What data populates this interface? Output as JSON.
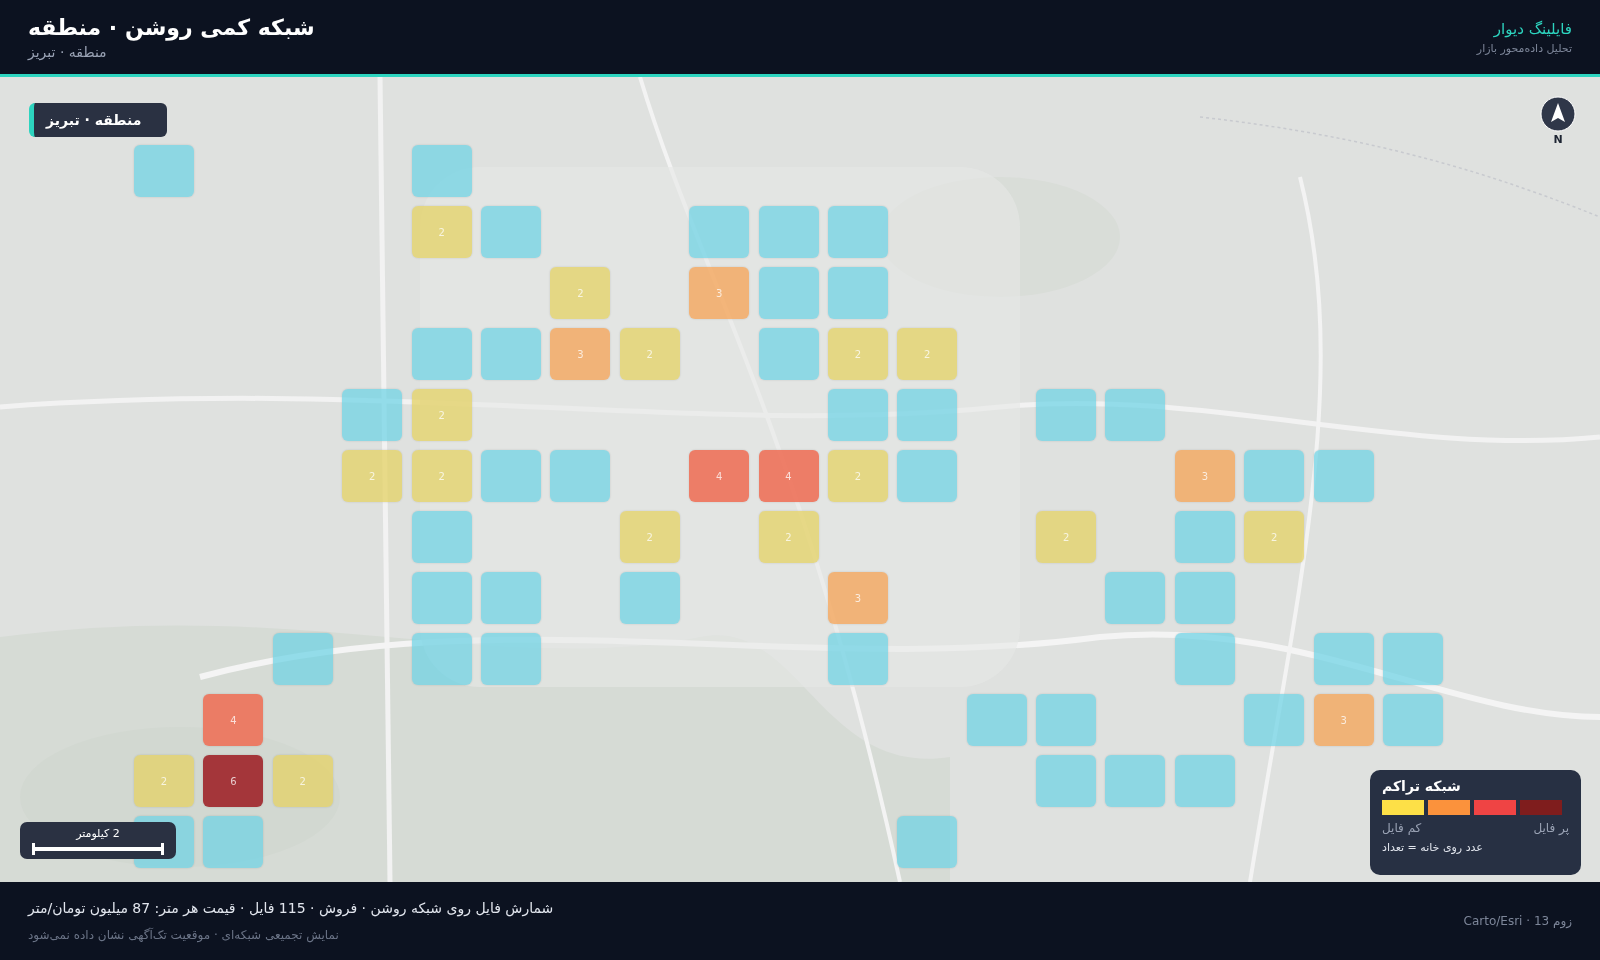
{
  "header": {
    "title": "شبکه کمی روشن · منطقه",
    "subtitle": "منطقه · تبریز",
    "brand": "فایلینگ دیوار",
    "tagline": "تحلیل داده‌محور بازار"
  },
  "map": {
    "badge": "منطقه · تبریز",
    "north": "N",
    "scale": "2 کیلومتر",
    "grid": {
      "rows": [
        [
          {
            "kind": "none"
          },
          {
            "kind": "none"
          },
          {
            "kind": "none"
          },
          {
            "kind": "none"
          },
          {
            "kind": "none"
          },
          {
            "kind": "none"
          },
          {
            "kind": "none"
          },
          {
            "kind": "none"
          },
          {
            "kind": "none"
          },
          {
            "kind": "none"
          },
          {
            "kind": "none"
          },
          {
            "kind": "none"
          },
          {
            "kind": "none"
          },
          {
            "kind": "none"
          },
          {
            "kind": "one"
          },
          {
            "kind": "none"
          },
          {
            "kind": "none"
          },
          {
            "kind": "none"
          },
          {
            "kind": "one"
          }
        ],
        [
          {
            "kind": "none"
          },
          {
            "kind": "none"
          },
          {
            "kind": "none"
          },
          {
            "kind": "none"
          },
          {
            "kind": "none"
          },
          {
            "kind": "none"
          },
          {
            "kind": "none"
          },
          {
            "kind": "none"
          },
          {
            "kind": "one"
          },
          {
            "kind": "one"
          },
          {
            "kind": "one"
          },
          {
            "kind": "none"
          },
          {
            "kind": "none"
          },
          {
            "kind": "one"
          },
          {
            "kind": "low",
            "count": "2"
          },
          {
            "kind": "none"
          },
          {
            "kind": "none"
          },
          {
            "kind": "none"
          },
          {
            "kind": "none"
          }
        ],
        [
          {
            "kind": "none"
          },
          {
            "kind": "none"
          },
          {
            "kind": "none"
          },
          {
            "kind": "none"
          },
          {
            "kind": "none"
          },
          {
            "kind": "none"
          },
          {
            "kind": "none"
          },
          {
            "kind": "none"
          },
          {
            "kind": "one"
          },
          {
            "kind": "one"
          },
          {
            "kind": "mid",
            "count": "3"
          },
          {
            "kind": "none"
          },
          {
            "kind": "low",
            "count": "2"
          },
          {
            "kind": "none"
          },
          {
            "kind": "none"
          },
          {
            "kind": "none"
          },
          {
            "kind": "none"
          },
          {
            "kind": "none"
          },
          {
            "kind": "none"
          }
        ],
        [
          {
            "kind": "none"
          },
          {
            "kind": "none"
          },
          {
            "kind": "none"
          },
          {
            "kind": "none"
          },
          {
            "kind": "none"
          },
          {
            "kind": "none"
          },
          {
            "kind": "none"
          },
          {
            "kind": "low",
            "count": "2"
          },
          {
            "kind": "low",
            "count": "2"
          },
          {
            "kind": "one"
          },
          {
            "kind": "none"
          },
          {
            "kind": "low",
            "count": "2"
          },
          {
            "kind": "mid",
            "count": "3"
          },
          {
            "kind": "one"
          },
          {
            "kind": "one"
          },
          {
            "kind": "none"
          },
          {
            "kind": "none"
          },
          {
            "kind": "none"
          },
          {
            "kind": "none"
          }
        ],
        [
          {
            "kind": "none"
          },
          {
            "kind": "none"
          },
          {
            "kind": "none"
          },
          {
            "kind": "none"
          },
          {
            "kind": "one"
          },
          {
            "kind": "one"
          },
          {
            "kind": "none"
          },
          {
            "kind": "one"
          },
          {
            "kind": "one"
          },
          {
            "kind": "none"
          },
          {
            "kind": "none"
          },
          {
            "kind": "none"
          },
          {
            "kind": "none"
          },
          {
            "kind": "none"
          },
          {
            "kind": "low",
            "count": "2"
          },
          {
            "kind": "one"
          },
          {
            "kind": "none"
          },
          {
            "kind": "none"
          },
          {
            "kind": "none"
          }
        ],
        [
          {
            "kind": "none"
          },
          {
            "kind": "one"
          },
          {
            "kind": "one"
          },
          {
            "kind": "mid",
            "count": "3"
          },
          {
            "kind": "none"
          },
          {
            "kind": "none"
          },
          {
            "kind": "none"
          },
          {
            "kind": "one"
          },
          {
            "kind": "low",
            "count": "2"
          },
          {
            "kind": "high",
            "count": "4"
          },
          {
            "kind": "high",
            "count": "4"
          },
          {
            "kind": "none"
          },
          {
            "kind": "one"
          },
          {
            "kind": "one"
          },
          {
            "kind": "low",
            "count": "2"
          },
          {
            "kind": "low",
            "count": "2"
          },
          {
            "kind": "none"
          },
          {
            "kind": "none"
          },
          {
            "kind": "none"
          }
        ],
        [
          {
            "kind": "none"
          },
          {
            "kind": "none"
          },
          {
            "kind": "low",
            "count": "2"
          },
          {
            "kind": "one"
          },
          {
            "kind": "none"
          },
          {
            "kind": "low",
            "count": "2"
          },
          {
            "kind": "none"
          },
          {
            "kind": "none"
          },
          {
            "kind": "none"
          },
          {
            "kind": "low",
            "count": "2"
          },
          {
            "kind": "none"
          },
          {
            "kind": "low",
            "count": "2"
          },
          {
            "kind": "none"
          },
          {
            "kind": "none"
          },
          {
            "kind": "one"
          },
          {
            "kind": "none"
          },
          {
            "kind": "none"
          },
          {
            "kind": "none"
          },
          {
            "kind": "none"
          }
        ],
        [
          {
            "kind": "none"
          },
          {
            "kind": "none"
          },
          {
            "kind": "none"
          },
          {
            "kind": "one"
          },
          {
            "kind": "one"
          },
          {
            "kind": "none"
          },
          {
            "kind": "none"
          },
          {
            "kind": "none"
          },
          {
            "kind": "mid",
            "count": "3"
          },
          {
            "kind": "none"
          },
          {
            "kind": "none"
          },
          {
            "kind": "one"
          },
          {
            "kind": "none"
          },
          {
            "kind": "one"
          },
          {
            "kind": "one"
          },
          {
            "kind": "none"
          },
          {
            "kind": "none"
          },
          {
            "kind": "none"
          },
          {
            "kind": "none"
          }
        ],
        [
          {
            "kind": "one"
          },
          {
            "kind": "one"
          },
          {
            "kind": "none"
          },
          {
            "kind": "one"
          },
          {
            "kind": "none"
          },
          {
            "kind": "none"
          },
          {
            "kind": "none"
          },
          {
            "kind": "none"
          },
          {
            "kind": "one"
          },
          {
            "kind": "none"
          },
          {
            "kind": "none"
          },
          {
            "kind": "none"
          },
          {
            "kind": "none"
          },
          {
            "kind": "one"
          },
          {
            "kind": "one"
          },
          {
            "kind": "none"
          },
          {
            "kind": "one"
          },
          {
            "kind": "none"
          },
          {
            "kind": "none"
          }
        ],
        [
          {
            "kind": "one"
          },
          {
            "kind": "mid",
            "count": "3"
          },
          {
            "kind": "one"
          },
          {
            "kind": "none"
          },
          {
            "kind": "none"
          },
          {
            "kind": "one"
          },
          {
            "kind": "one"
          },
          {
            "kind": "none"
          },
          {
            "kind": "none"
          },
          {
            "kind": "none"
          },
          {
            "kind": "none"
          },
          {
            "kind": "none"
          },
          {
            "kind": "none"
          },
          {
            "kind": "none"
          },
          {
            "kind": "none"
          },
          {
            "kind": "none"
          },
          {
            "kind": "none"
          },
          {
            "kind": "high",
            "count": "4"
          },
          {
            "kind": "none"
          }
        ],
        [
          {
            "kind": "none"
          },
          {
            "kind": "none"
          },
          {
            "kind": "none"
          },
          {
            "kind": "one"
          },
          {
            "kind": "one"
          },
          {
            "kind": "one"
          },
          {
            "kind": "none"
          },
          {
            "kind": "none"
          },
          {
            "kind": "none"
          },
          {
            "kind": "none"
          },
          {
            "kind": "none"
          },
          {
            "kind": "none"
          },
          {
            "kind": "none"
          },
          {
            "kind": "none"
          },
          {
            "kind": "none"
          },
          {
            "kind": "none"
          },
          {
            "kind": "low",
            "count": "2"
          },
          {
            "kind": "max",
            "count": "6"
          },
          {
            "kind": "low",
            "count": "2"
          }
        ],
        [
          {
            "kind": "none"
          },
          {
            "kind": "none"
          },
          {
            "kind": "none"
          },
          {
            "kind": "none"
          },
          {
            "kind": "none"
          },
          {
            "kind": "none"
          },
          {
            "kind": "none"
          },
          {
            "kind": "one"
          },
          {
            "kind": "none"
          },
          {
            "kind": "none"
          },
          {
            "kind": "none"
          },
          {
            "kind": "none"
          },
          {
            "kind": "none"
          },
          {
            "kind": "none"
          },
          {
            "kind": "none"
          },
          {
            "kind": "none"
          },
          {
            "kind": "none"
          },
          {
            "kind": "one"
          },
          {
            "kind": "one"
          }
        ]
      ]
    },
    "legend": {
      "title": "شبکه تراکم",
      "swatches": [
        {
          "color": "#fde047"
        },
        {
          "color": "#fb923c"
        },
        {
          "color": "#ef4444"
        },
        {
          "color": "#7f1d1d"
        }
      ],
      "low_label": "کم فایل",
      "high_label": "پر فایل",
      "note": "عدد روی خانه = تعداد"
    }
  },
  "footer": {
    "summary": "شمارش فایل روی شبکه روشن · فروش · 115 فایل · قیمت هر متر: 87 میلیون تومان/متر",
    "note": "نمایش تجمیعی شبکه‌ای · موقعیت تک‌آگهی نشان داده نمی‌شود",
    "source": "زوم 13 · Carto/Esri"
  }
}
